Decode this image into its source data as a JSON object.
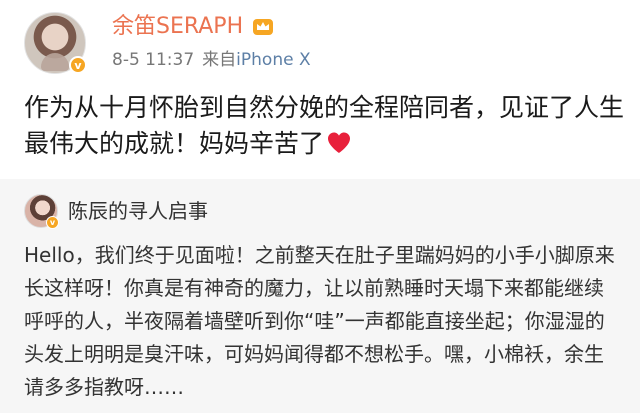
{
  "post": {
    "author": {
      "name": "余笛SERAPH",
      "timestamp": "8-5 11:37",
      "source_prefix": "来自",
      "source_device": "iPhone X"
    },
    "text": "作为从十月怀胎到自然分娩的全程陪同者，见证了人生最伟大的成就！妈妈辛苦了",
    "emoji": "heart-icon"
  },
  "repost": {
    "author": {
      "name": "陈辰的寻人启事"
    },
    "text": "Hello，我们终于见面啦！之前整天在肚子里踹妈妈的小手小脚原来长这样呀！你真是有神奇的魔力，让以前熟睡时天塌下来都能继续呼呼的人，半夜隔着墙壁听到你“哇”一声都能直接坐起；你湿湿的头发上明明是臭汗味，可妈妈闻得都不想松手。嘿，小棉袄，余生请多多指教呀……"
  },
  "colors": {
    "username": "#eb7350",
    "meta": "#777777",
    "repost_bg": "#f6f6f6",
    "heart": "#e8203b",
    "verified": "#f6a623"
  }
}
